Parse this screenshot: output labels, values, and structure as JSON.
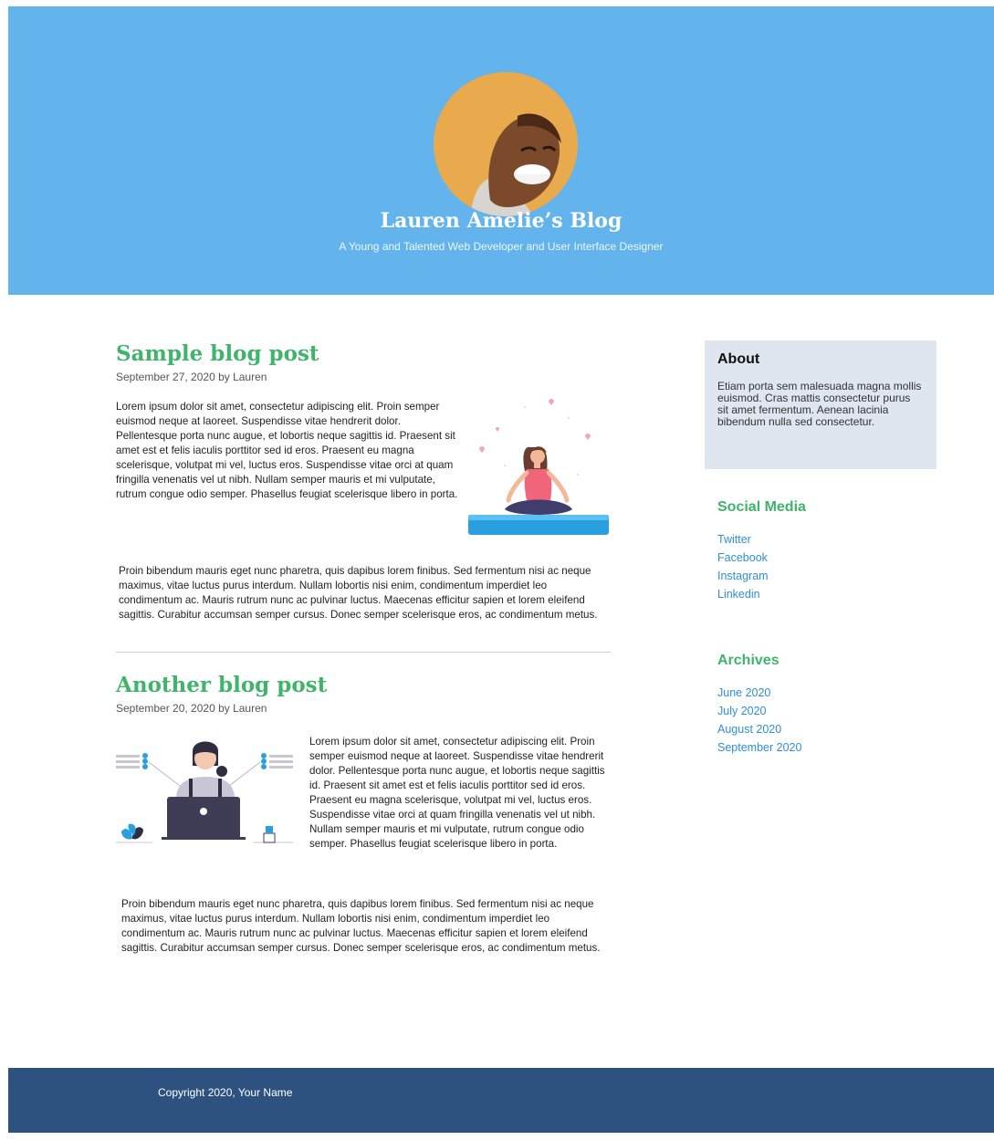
{
  "header": {
    "title": "Lauren Amelie’s Blog",
    "subtitle": "A Young and Talented Web Developer and User Interface Designer"
  },
  "posts": [
    {
      "title": "Sample blog post",
      "meta": "September 27, 2020 by Lauren",
      "paragraphs": [
        "Lorem ipsum dolor sit amet, consectetur adipiscing elit. Proin semper euismod neque at laoreet. Suspendisse vitae hendrerit dolor. Pellentesque porta nunc augue, et lobortis neque sagittis id. Praesent sit amet est et felis iaculis porttitor sed id eros. Praesent eu magna scelerisque, volutpat mi vel, luctus eros. Suspendisse vitae orci at quam fringilla venenatis vel ut nibh. Nullam semper mauris et mi vulputate, rutrum congue odio semper. Phasellus feugiat scelerisque libero in porta.",
        "Proin bibendum mauris eget nunc pharetra, quis dapibus lorem finibus. Sed fermentum nisi ac neque maximus, vitae luctus purus interdum. Nullam lobortis nisi enim, condimentum imperdiet leo condimentum ac. Mauris rutrum nunc ac pulvinar luctus. Maecenas efficitur sapien et lorem eleifend sagittis. Curabitur accumsan semper cursus. Donec semper scelerisque eros, ac condimentum metus."
      ]
    },
    {
      "title": "Another blog post",
      "meta": "September 20, 2020 by Lauren",
      "paragraphs": [
        "Lorem ipsum dolor sit amet, consectetur adipiscing elit. Proin semper euismod neque at laoreet. Suspendisse vitae hendrerit dolor. Pellentesque porta nunc augue, et lobortis neque sagittis id. Praesent sit amet est et felis iaculis porttitor sed id eros. Praesent eu magna scelerisque, volutpat mi vel, luctus eros. Suspendisse vitae orci at quam fringilla venenatis vel ut nibh. Nullam semper mauris et mi vulputate, rutrum congue odio semper. Phasellus feugiat scelerisque libero in porta.",
        "Proin bibendum mauris eget nunc pharetra, quis dapibus lorem finibus. Sed fermentum nisi ac neque maximus, vitae luctus purus interdum. Nullam lobortis nisi enim, condimentum imperdiet leo condimentum ac. Mauris rutrum nunc ac pulvinar luctus. Maecenas efficitur sapien et lorem eleifend sagittis. Curabitur accumsan semper cursus. Donec semper scelerisque eros, ac condimentum metus."
      ]
    }
  ],
  "sidebar": {
    "about": {
      "heading": "About",
      "text": "Etiam porta sem malesuada magna mollis euismod. Cras mattis consectetur purus sit amet fermentum. Aenean lacinia bibendum nulla sed consectetur."
    },
    "social": {
      "heading": "Social Media",
      "links": [
        "Twitter",
        "Facebook",
        "Instagram",
        "Linkedin"
      ]
    },
    "archives": {
      "heading": "Archives",
      "links": [
        "June 2020",
        "July 2020",
        "August 2020",
        "September 2020"
      ]
    }
  },
  "footer": {
    "text": "Copyright 2020, Your Name"
  },
  "colors": {
    "header_bg": "#63b3ec",
    "accent_green": "#3fb46a",
    "link_blue": "#2f8fd6",
    "about_bg": "#dfe6ef",
    "footer_bg": "#2e5280"
  },
  "icons": [
    "avatar-photo",
    "yoga-illustration",
    "working-illustration"
  ]
}
